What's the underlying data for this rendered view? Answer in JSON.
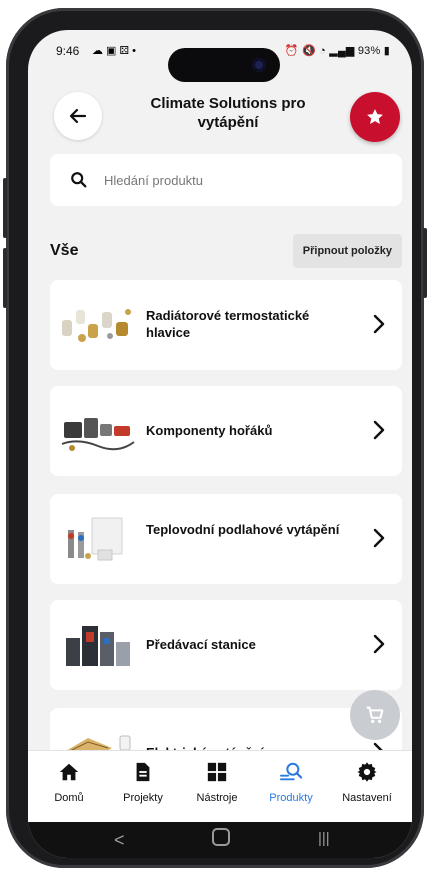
{
  "status": {
    "time": "9:46",
    "battery": "93%"
  },
  "header": {
    "title": "Climate Solutions pro vytápění"
  },
  "search": {
    "placeholder": "Hledání produktu"
  },
  "section": {
    "label": "Vše",
    "pin_button": "Připnout položky"
  },
  "categories": [
    {
      "label": "Radiátorové termostatické hlavice"
    },
    {
      "label": "Komponenty hořáků"
    },
    {
      "label": "Teplovodní podlahové vytápění"
    },
    {
      "label": "Předávací stanice"
    },
    {
      "label": "Elektrické vytápění"
    }
  ],
  "nav": {
    "items": [
      {
        "label": "Domů",
        "icon": "home-icon"
      },
      {
        "label": "Projekty",
        "icon": "document-icon"
      },
      {
        "label": "Nástroje",
        "icon": "grid-icon"
      },
      {
        "label": "Produkty",
        "icon": "search-products-icon",
        "active": true
      },
      {
        "label": "Nastavení",
        "icon": "gear-icon"
      }
    ]
  },
  "colors": {
    "accent_red": "#c8102e",
    "active_blue": "#2a7ae2",
    "background": "#f2f2f2"
  }
}
